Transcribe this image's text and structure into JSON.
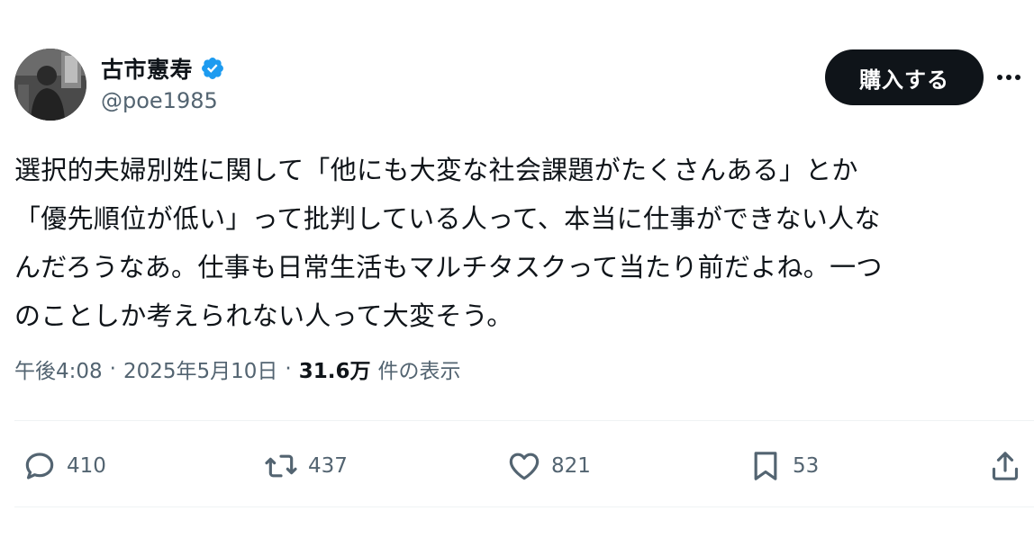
{
  "author": {
    "name": "古市憲寿",
    "handle": "@poe1985",
    "verified_color": "#1d9bf0"
  },
  "buy_button_label": "購入する",
  "tweet": {
    "text": "選択的夫婦別姓に関して「他にも大変な社会課題がたくさんある」とか\n「優先順位が低い」って批判している人って、本当に仕事ができない人な\nんだろうなあ。仕事も日常生活もマルチタスクって当たり前だよね。一つ\nのことしか考えられない人って大変そう。"
  },
  "meta": {
    "time": "午後4:08",
    "separator": "·",
    "date": "2025年5月10日",
    "views_count": "31.6万",
    "views_label": "件の表示"
  },
  "actions": {
    "replies": "410",
    "retweets": "437",
    "likes": "821",
    "bookmarks": "53"
  },
  "icons": {
    "reply": "reply-icon",
    "retweet": "retweet-icon",
    "like": "heart-icon",
    "bookmark": "bookmark-icon",
    "share": "share-icon",
    "more": "more-icon"
  }
}
